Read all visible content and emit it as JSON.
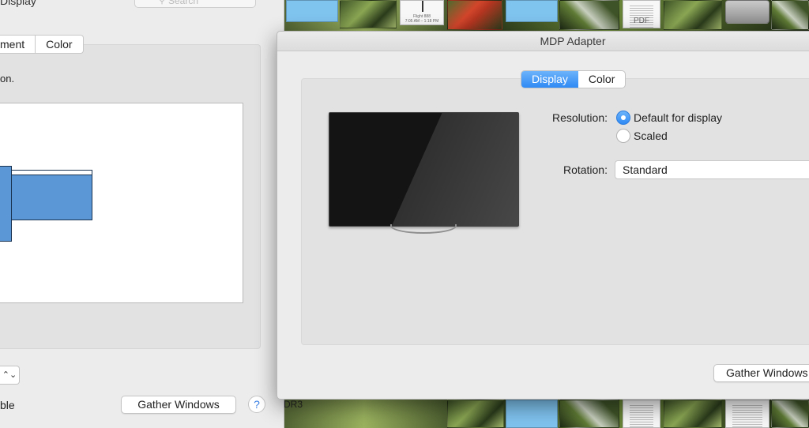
{
  "desktop": {
    "thumb_doc_caption": "Flight 888",
    "thumb_doc_time": "7:05 AM – 1:18 PM",
    "pdf_label": "PDF",
    "partial_label": "DR3"
  },
  "back_window": {
    "title": "Display",
    "search_placeholder": "Search",
    "tabs": [
      {
        "label": "ment"
      },
      {
        "label": "Color"
      }
    ],
    "instruction": "on.",
    "stepper_icon": "⌃⌄",
    "ble_text": "ble",
    "gather_label": "Gather Windows",
    "help_label": "?"
  },
  "front_window": {
    "title": "MDP Adapter",
    "tabs": [
      {
        "label": "Display",
        "selected": true
      },
      {
        "label": "Color",
        "selected": false
      }
    ],
    "resolution_label": "Resolution:",
    "resolution_options": [
      {
        "label": "Default for display",
        "selected": true
      },
      {
        "label": "Scaled",
        "selected": false
      }
    ],
    "rotation_label": "Rotation:",
    "rotation_value": "Standard",
    "gather_label": "Gather Windows"
  },
  "colors": {
    "accent": "#2f8af4",
    "arrangement_display": "#5b96d6"
  }
}
